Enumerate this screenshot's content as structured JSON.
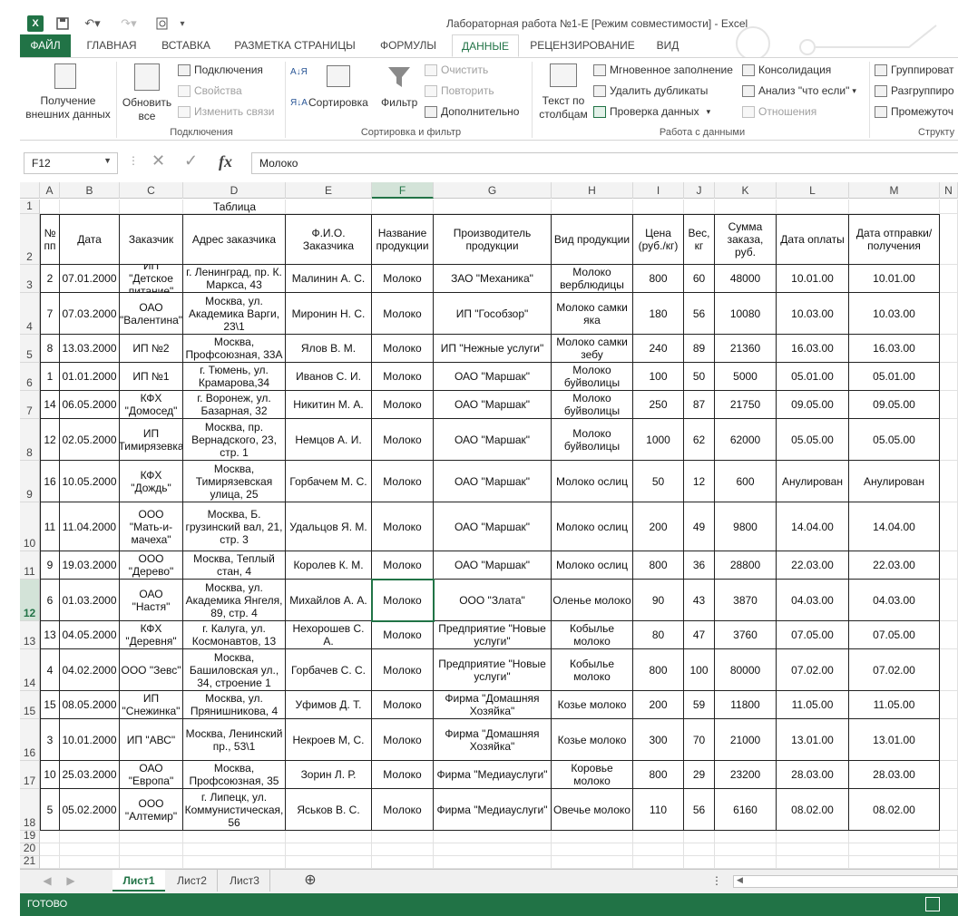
{
  "window": {
    "title": "Лабораторная работа №1-Е  [Режим совместимости] - Excel",
    "app_icon": "X"
  },
  "tabs": [
    "ФАЙЛ",
    "ГЛАВНАЯ",
    "ВСТАВКА",
    "РАЗМЕТКА СТРАНИЦЫ",
    "ФОРМУЛЫ",
    "ДАННЫЕ",
    "РЕЦЕНЗИРОВАНИЕ",
    "ВИД"
  ],
  "active_tab": "ДАННЫЕ",
  "ribbon": {
    "get_data": "Получение внешних данных",
    "refresh_all": "Обновить все",
    "connections": "Подключения",
    "properties": "Свойства",
    "edit_links": "Изменить связи",
    "group_connections": "Подключения",
    "sort": "Сортировка",
    "filter": "Фильтр",
    "clear": "Очистить",
    "reapply": "Повторить",
    "advanced": "Дополнительно",
    "group_sort": "Сортировка и фильтр",
    "text_to_columns": "Текст по столбцам",
    "flash_fill": "Мгновенное заполнение",
    "remove_duplicates": "Удалить дубликаты",
    "data_validation": "Проверка данных",
    "consolidate": "Консолидация",
    "what_if": "Анализ \"что если\"",
    "relationships": "Отношения",
    "group_data_tools": "Работа с данными",
    "group_btn": "Группироват",
    "ungroup_btn": "Разгруппиро",
    "subtotal_btn": "Промежуточ",
    "group_outline": "Структу"
  },
  "formula_bar": {
    "name_box": "F12",
    "formula": "Молоко"
  },
  "columns": [
    "A",
    "B",
    "C",
    "D",
    "E",
    "F",
    "G",
    "H",
    "I",
    "J",
    "K",
    "L",
    "M",
    "N"
  ],
  "selected_column": "F",
  "selected_row": "12",
  "table": {
    "title": "Таблица",
    "headers": [
      "№ пп",
      "Дата",
      "Заказчик",
      "Адрес заказчика",
      "Ф.И.О. Заказчика",
      "Название продукции",
      "Производитель продукции",
      "Вид продукции",
      "Цена (руб./кг)",
      "Вес, кг",
      "Сумма заказа, руб.",
      "Дата оплаты",
      "Дата отправки/получения"
    ],
    "rows": [
      {
        "row": "3",
        "cells": [
          "2",
          "07.01.2000",
          "ИП \"Детское питание\"",
          "г. Ленинград, пр. К. Маркса, 43",
          "Малинин А. С.",
          "Молоко",
          "ЗАО \"Механика\"",
          "Молоко верблюдицы",
          "800",
          "60",
          "48000",
          "10.01.00",
          "10.01.00"
        ]
      },
      {
        "row": "4",
        "cells": [
          "7",
          "07.03.2000",
          "ОАО \"Валентина\"",
          "Москва, ул. Академика Варги, 23\\1",
          "Миронин Н. С.",
          "Молоко",
          "ИП \"Гособзор\"",
          "Молоко самки яка",
          "180",
          "56",
          "10080",
          "10.03.00",
          "10.03.00"
        ]
      },
      {
        "row": "5",
        "cells": [
          "8",
          "13.03.2000",
          "ИП №2",
          "Москва, Профсоюзная, 33А",
          "Ялов В. М.",
          "Молоко",
          "ИП \"Нежные услуги\"",
          "Молоко самки зебу",
          "240",
          "89",
          "21360",
          "16.03.00",
          "16.03.00"
        ]
      },
      {
        "row": "6",
        "cells": [
          "1",
          "01.01.2000",
          "ИП №1",
          "г. Тюмень, ул. Крамарова,34",
          "Иванов С. И.",
          "Молоко",
          "ОАО \"Маршак\"",
          "Молоко буйволицы",
          "100",
          "50",
          "5000",
          "05.01.00",
          "05.01.00"
        ]
      },
      {
        "row": "7",
        "cells": [
          "14",
          "06.05.2000",
          "КФХ \"Домосед\"",
          "г. Воронеж, ул. Базарная, 32",
          "Никитин М. А.",
          "Молоко",
          "ОАО \"Маршак\"",
          "Молоко буйволицы",
          "250",
          "87",
          "21750",
          "09.05.00",
          "09.05.00"
        ]
      },
      {
        "row": "8",
        "cells": [
          "12",
          "02.05.2000",
          "ИП \"Тимирязевка\"",
          "Москва, пр. Вернадского, 23, стр. 1",
          "Немцов А. И.",
          "Молоко",
          "ОАО \"Маршак\"",
          "Молоко буйволицы",
          "1000",
          "62",
          "62000",
          "05.05.00",
          "05.05.00"
        ]
      },
      {
        "row": "9",
        "cells": [
          "16",
          "10.05.2000",
          "КФХ \"Дождь\"",
          "Москва, Тимирязевская улица, 25",
          "Горбачем М. С.",
          "Молоко",
          "ОАО \"Маршак\"",
          "Молоко ослиц",
          "50",
          "12",
          "600",
          "Анулирован",
          "Анулирован"
        ]
      },
      {
        "row": "10",
        "cells": [
          "11",
          "11.04.2000",
          "ООО \"Мать-и-мачеха\"",
          "Москва, Б. грузинский вал, 21, стр. 3",
          "Удальцов Я. М.",
          "Молоко",
          "ОАО \"Маршак\"",
          "Молоко ослиц",
          "200",
          "49",
          "9800",
          "14.04.00",
          "14.04.00"
        ]
      },
      {
        "row": "11",
        "cells": [
          "9",
          "19.03.2000",
          "ООО \"Дерево\"",
          "Москва, Теплый стан, 4",
          "Королев К. М.",
          "Молоко",
          "ОАО \"Маршак\"",
          "Молоко ослиц",
          "800",
          "36",
          "28800",
          "22.03.00",
          "22.03.00"
        ]
      },
      {
        "row": "12",
        "cells": [
          "6",
          "01.03.2000",
          "ОАО \"Настя\"",
          "Москва, ул. Академика Янгеля, 89, стр. 4",
          "Михайлов А. А.",
          "Молоко",
          "ООО \"Злата\"",
          "Оленье молоко",
          "90",
          "43",
          "3870",
          "04.03.00",
          "04.03.00"
        ]
      },
      {
        "row": "13",
        "cells": [
          "13",
          "04.05.2000",
          "КФХ \"Деревня\"",
          "г. Калуга, ул. Космонавтов, 13",
          "Нехорошев С. А.",
          "Молоко",
          "Предприятие \"Новые услуги\"",
          "Кобылье молоко",
          "80",
          "47",
          "3760",
          "07.05.00",
          "07.05.00"
        ]
      },
      {
        "row": "14",
        "cells": [
          "4",
          "04.02.2000",
          "ООО \"Зевс\"",
          "Москва, Башиловская ул., 34, строение 1",
          "Горбачев С. С.",
          "Молоко",
          "Предприятие \"Новые услуги\"",
          "Кобылье молоко",
          "800",
          "100",
          "80000",
          "07.02.00",
          "07.02.00"
        ]
      },
      {
        "row": "15",
        "cells": [
          "15",
          "08.05.2000",
          "ИП \"Снежинка\"",
          "Москва, ул. Прянишникова, 4",
          "Уфимов Д. Т.",
          "Молоко",
          "Фирма \"Домашняя Хозяйка\"",
          "Козье молоко",
          "200",
          "59",
          "11800",
          "11.05.00",
          "11.05.00"
        ]
      },
      {
        "row": "16",
        "cells": [
          "3",
          "10.01.2000",
          "ИП \"АВС\"",
          "Москва, Ленинский пр., 53\\1",
          "Некроев М, С.",
          "Молоко",
          "Фирма \"Домашняя Хозяйка\"",
          "Козье молоко",
          "300",
          "70",
          "21000",
          "13.01.00",
          "13.01.00"
        ]
      },
      {
        "row": "17",
        "cells": [
          "10",
          "25.03.2000",
          "ОАО \"Европа\"",
          "Москва, Профсоюзная, 35",
          "Зорин Л. Р.",
          "Молоко",
          "Фирма \"Медиауслуги\"",
          "Коровье молоко",
          "800",
          "29",
          "23200",
          "28.03.00",
          "28.03.00"
        ]
      },
      {
        "row": "18",
        "cells": [
          "5",
          "05.02.2000",
          "ООО \"Алтемир\"",
          "г. Липецк, ул. Коммунистическая, 56",
          "Яськов В. С.",
          "Молоко",
          "Фирма \"Медиауслуги\"",
          "Овечье молоко",
          "110",
          "56",
          "6160",
          "08.02.00",
          "08.02.00"
        ]
      }
    ]
  },
  "extra_rows": [
    "19",
    "20",
    "21"
  ],
  "sheets": [
    "Лист1",
    "Лист2",
    "Лист3"
  ],
  "active_sheet": "Лист1",
  "status": "ГОТОВО",
  "colors": {
    "accent": "#217346"
  }
}
